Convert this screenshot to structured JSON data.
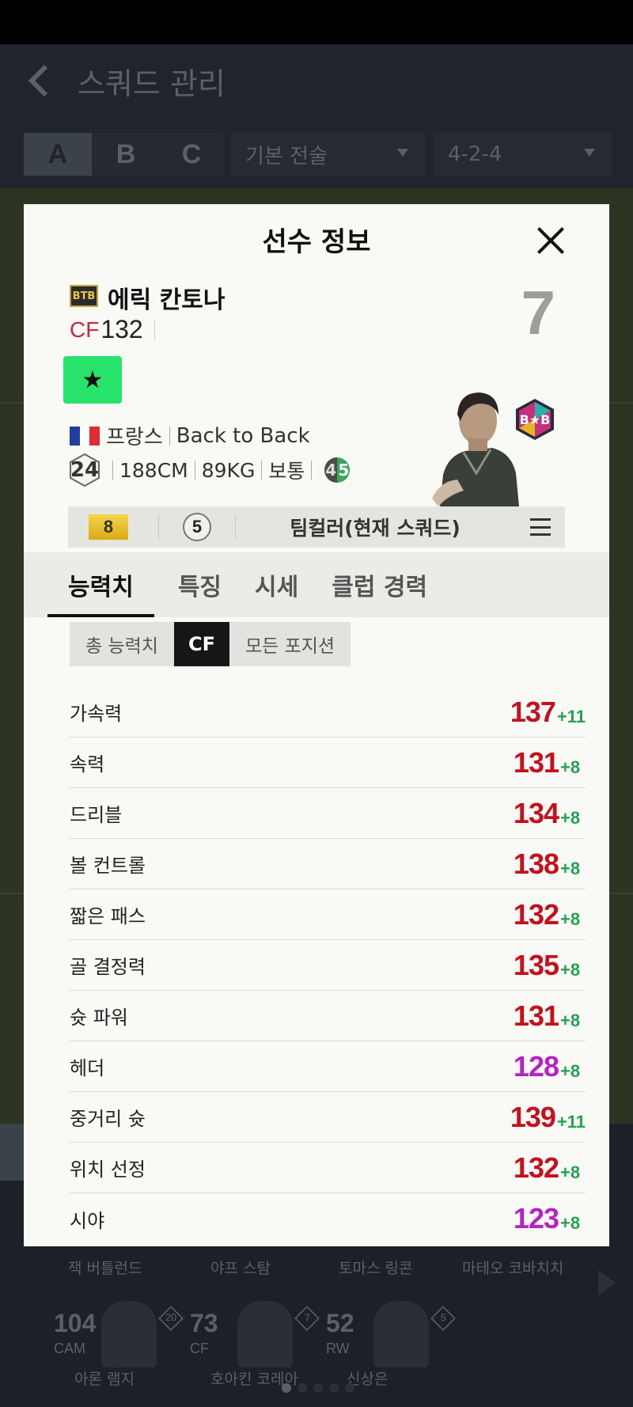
{
  "background": {
    "header_title": "스쿼드 관리",
    "squad_tabs": [
      "A",
      "B",
      "C"
    ],
    "tactic_dropdown": "기본 전술",
    "formation_dropdown": "4-2-4",
    "bench_names": [
      "잭 버틀런드",
      "야프 스탐",
      "토마스 링콘",
      "마테오 코바치치"
    ],
    "bench_players": [
      {
        "ovr": "104",
        "pos": "CAM",
        "lvl": "20",
        "name": "아론 램지"
      },
      {
        "ovr": "73",
        "pos": "CF",
        "lvl": "7",
        "name": "호아킨 코레아"
      },
      {
        "ovr": "52",
        "pos": "RW",
        "lvl": "5",
        "name": "신상은"
      }
    ]
  },
  "modal": {
    "title": "선수 정보",
    "season_badge": "BTB",
    "player_name": "에릭 칸토나",
    "position": "CF",
    "overall": "132",
    "jersey_number": "7",
    "star_icon": "★",
    "nation": "프랑스",
    "season": "Back to Back",
    "age": "24",
    "height": "188CM",
    "weight": "89KG",
    "body_type": "보통",
    "weak_foot": "4",
    "strong_foot": "5",
    "upgrade_level": "8",
    "team_color_count": "5",
    "team_color_label": "팀컬러(현재 스쿼드)",
    "tabs": [
      "능력치",
      "특징",
      "시세",
      "클럽 경력"
    ],
    "subtabs": [
      "총 능력치",
      "CF",
      "모든 포지션"
    ],
    "stats": [
      {
        "label": "가속력",
        "value": "137",
        "bonus": "+11",
        "color": "#c3121e"
      },
      {
        "label": "속력",
        "value": "131",
        "bonus": "+8",
        "color": "#c3121e"
      },
      {
        "label": "드리블",
        "value": "134",
        "bonus": "+8",
        "color": "#c3121e"
      },
      {
        "label": "볼 컨트롤",
        "value": "138",
        "bonus": "+8",
        "color": "#c3121e"
      },
      {
        "label": "짧은 패스",
        "value": "132",
        "bonus": "+8",
        "color": "#c3121e"
      },
      {
        "label": "골 결정력",
        "value": "135",
        "bonus": "+8",
        "color": "#c3121e"
      },
      {
        "label": "슛 파워",
        "value": "131",
        "bonus": "+8",
        "color": "#c3121e"
      },
      {
        "label": "헤더",
        "value": "128",
        "bonus": "+8",
        "color": "#b623c4"
      },
      {
        "label": "중거리 슛",
        "value": "139",
        "bonus": "+11",
        "color": "#c3121e"
      },
      {
        "label": "위치 선정",
        "value": "132",
        "bonus": "+8",
        "color": "#c3121e"
      },
      {
        "label": "시야",
        "value": "123",
        "bonus": "+8",
        "color": "#b623c4"
      }
    ]
  }
}
